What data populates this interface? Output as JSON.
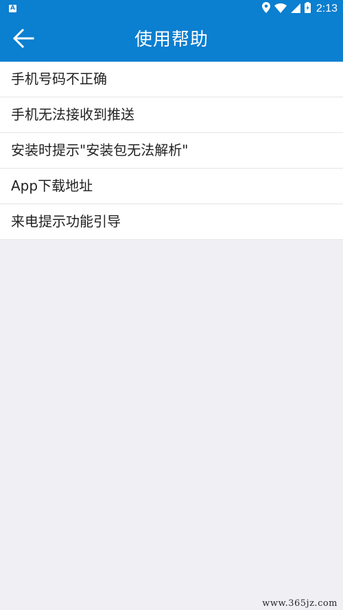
{
  "status_bar": {
    "time": "2:13",
    "left_icon": "A",
    "icons": [
      "location-icon",
      "wifi-icon",
      "signal-icon",
      "battery-icon"
    ]
  },
  "header": {
    "title": "使用帮助",
    "back_icon": "back-arrow-icon"
  },
  "help_items": [
    {
      "label": "手机号码不正确"
    },
    {
      "label": "手机无法接收到推送"
    },
    {
      "label": "安装时提示\"安装包无法解析\""
    },
    {
      "label": "App下载地址"
    },
    {
      "label": "来电提示功能引导"
    }
  ],
  "watermark": "www.365jz.com",
  "colors": {
    "primary": "#0b7fd0",
    "background": "#efeff4",
    "list_bg": "#ffffff",
    "divider": "#e4e4e4"
  }
}
